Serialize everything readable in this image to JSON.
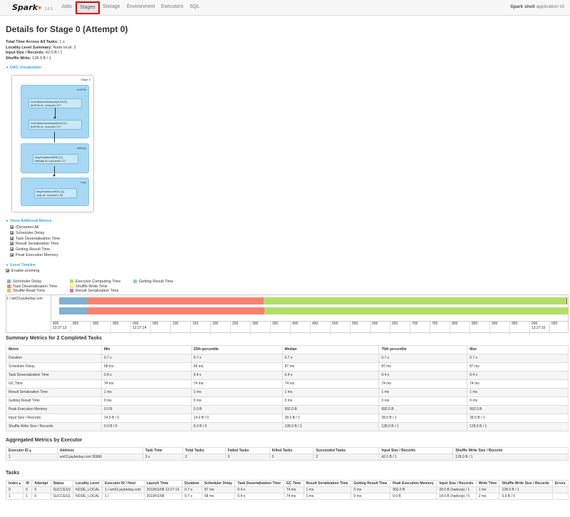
{
  "nav": {
    "brand": "Spark",
    "version": "1.6.3",
    "items": [
      "Jobs",
      "Stages",
      "Storage",
      "Environment",
      "Executors",
      "SQL"
    ],
    "active": "Stages",
    "app_name": "Spark shell",
    "app_suffix": " application UI"
  },
  "page_title": "Details for Stage 0 (Attempt 0)",
  "summary": [
    {
      "label": "Total Time Across All Tasks:",
      "value": " 1 s"
    },
    {
      "label": "Locality Level Summary:",
      "value": " Node local: 2"
    },
    {
      "label": "Input Size / Records:",
      "value": " 42.0 B / 1"
    },
    {
      "label": "Shuffle Write:",
      "value": " 128.0 B / 1"
    }
  ],
  "dag": {
    "toggle": "DAG Visualization",
    "stage_label": "Stage 0",
    "clusters": [
      {
        "label": "textFile",
        "nodes": [
          {
            "l1": "/user/jiancha/samplejd.txt [0]",
            "l2": "textFile at <console>:27"
          },
          {
            "l1": "/user/jiancha/samplejd.txt [1]",
            "l2": "textFile at <console>:27"
          }
        ]
      },
      {
        "label": "flatMap",
        "nodes": [
          {
            "l1": "MapPartitionsRDD [2]",
            "l2": "flatMap at <console>:27"
          }
        ]
      },
      {
        "label": "map",
        "nodes": [
          {
            "l1": "MapPartitionsRDD [3]",
            "l2": "map at <console>:29"
          }
        ]
      }
    ]
  },
  "additional_metrics": {
    "toggle": "Show Additional Metrics",
    "items": [
      "(De)select All",
      "Scheduler Delay",
      "Task Deserialization Time",
      "Result Serialization Time",
      "Getting Result Time",
      "Peak Execution Memory"
    ]
  },
  "event_timeline": {
    "toggle": "Event Timeline",
    "zoom_label": "Enable zooming",
    "legend": [
      {
        "name": "Scheduler Delay",
        "color": "#80b1d3"
      },
      {
        "name": "Task Deserialization Time",
        "color": "#fb8072"
      },
      {
        "name": "Shuffle Read Time",
        "color": "#fdb462"
      },
      {
        "name": "Executor Computing Time",
        "color": "#b3de69"
      },
      {
        "name": "Shuffle Write Time",
        "color": "#ffed6f"
      },
      {
        "name": "Result Serialization Time",
        "color": "#bc80bd"
      },
      {
        "name": "Getting Result Time",
        "color": "#8dd3c7"
      }
    ],
    "executor_label": "1 / wn03.jaybeday.com",
    "ticks": [
      "800",
      "850",
      "900",
      "950",
      "000",
      "050",
      "100",
      "150",
      "200",
      "250",
      "300",
      "350",
      "400",
      "450",
      "500",
      "550",
      "600",
      "650",
      "700",
      "750",
      "800",
      "850",
      "900",
      "950",
      "000",
      "050"
    ],
    "time_labels": [
      {
        "after": 0,
        "text": "13:27:13"
      },
      {
        "after": 4,
        "text": "13:27:14"
      },
      {
        "after": 24,
        "text": "13:27:10"
      }
    ]
  },
  "summary_metrics": {
    "title": "Summary Metrics for 2 Completed Tasks",
    "headers": [
      "Metric",
      "Min",
      "25th percentile",
      "Median",
      "75th percentile",
      "Max"
    ],
    "rows": [
      [
        "Duration",
        "0.7 s",
        "0.7 s",
        "0.7 s",
        "0.7 s",
        "0.7 s"
      ],
      [
        "Scheduler Delay",
        "68 ms",
        "68 ms",
        "87 ms",
        "87 ms",
        "87 ms"
      ],
      [
        "Task Deserialization Time",
        "0.4 s",
        "0.4 s",
        "0.4 s",
        "0.4 s",
        "0.4 s"
      ],
      [
        "GC Time",
        "74 ms",
        "74 ms",
        "74 ms",
        "74 ms",
        "74 ms"
      ],
      [
        "Result Serialization Time",
        "1 ms",
        "1 ms",
        "1 ms",
        "1 ms",
        "1 ms"
      ],
      [
        "Getting Result Time",
        "0 ms",
        "0 ms",
        "0 ms",
        "0 ms",
        "0 ms"
      ],
      [
        "Peak Execution Memory",
        "0.0 B",
        "0.0 B",
        "992.0 B",
        "992.0 B",
        "992.0 B"
      ],
      [
        "Input Size / Records",
        "14.0 B / 0",
        "14.0 B / 0",
        "28.0 B / 1",
        "28.0 B / 1",
        "28.0 B / 1"
      ],
      [
        "Shuffle Write Size / Records",
        "0.0 B / 0",
        "0.0 B / 0",
        "128.0 B / 1",
        "128.0 B / 1",
        "128.0 B / 1"
      ]
    ]
  },
  "aggregated": {
    "title": "Aggregated Metrics by Executor",
    "headers": [
      "Executor ID ▴",
      "Address",
      "Task Time",
      "Total Tasks",
      "Failed Tasks",
      "Killed Tasks",
      "Succeeded Tasks",
      "Input Size / Records",
      "Shuffle Write Size / Records"
    ],
    "rows": [
      [
        "1",
        "wn03.jaybeday.com:36966",
        "3 s",
        "2",
        "0",
        "0",
        "2",
        "42.0 B / 1",
        "128.0 B / 1"
      ]
    ]
  },
  "tasks": {
    "title": "Tasks",
    "headers": [
      "Index ▴",
      "ID",
      "Attempt",
      "Status",
      "Locality Level",
      "Executor ID / Host",
      "Launch Time",
      "Duration",
      "Scheduler Delay",
      "Task Deserialization Time",
      "GC Time",
      "Result Serialization Time",
      "Getting Result Time",
      "Peak Execution Memory",
      "Input Size / Records",
      "Write Time",
      "Shuffle Write Size / Records",
      "Errors"
    ],
    "rows": [
      [
        "0",
        "0",
        "0",
        "SUCCESS",
        "NODE_LOCAL",
        "1 / wn03.jaybeday.com",
        "2019/01/08 12:27:13",
        "0.7 s",
        "87 ms",
        "0.4 s",
        "74 ms",
        "1 ms",
        "0 ms",
        "992.0 B",
        "28.0 B (hadoop) / 1",
        "1 ms",
        "128.0 B / 1",
        ""
      ],
      [
        "1",
        "1",
        "0",
        "SUCCESS",
        "NODE_LOCAL",
        "1 /",
        "2019/01/08",
        "0.7 s",
        "68 ms",
        "0.4 s",
        "74 ms",
        "1 ms",
        "0 ms",
        "0.0 B",
        "14.0 B (hadoop) / 0",
        "2 ms",
        "0.0 B / 0",
        ""
      ]
    ]
  }
}
